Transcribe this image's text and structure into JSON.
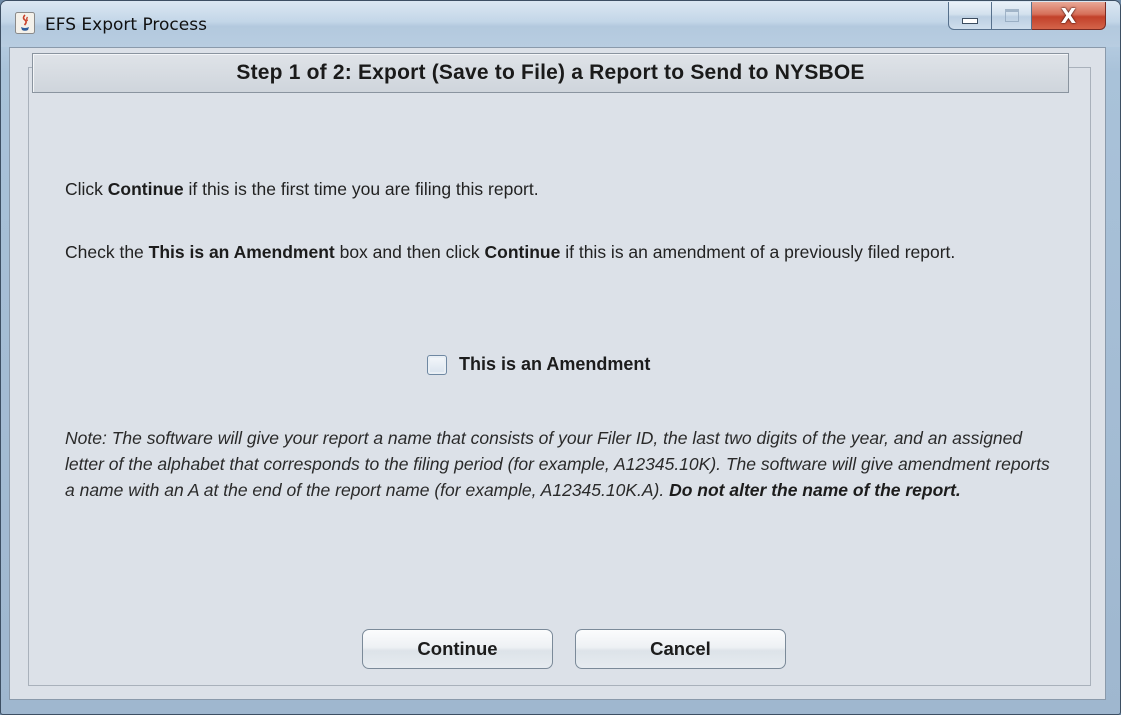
{
  "window": {
    "title": "EFS Export Process",
    "app_icon": "java-icon",
    "caption_buttons": {
      "minimize": "minimize-icon",
      "maximize": "maximize-icon",
      "close": "close-icon",
      "close_glyph": "X"
    }
  },
  "dialog": {
    "step_title": "Step 1 of 2:  Export (Save to File) a Report to Send to NYSBOE",
    "p1": {
      "before": "Click ",
      "bold1": "Continue",
      "after": " if this is the first time you are filing this report."
    },
    "p2": {
      "before": "Check the ",
      "bold1": "This is an Amendment",
      "middle": " box and then click ",
      "bold2": "Continue",
      "after": " if this is an amendment of a previously filed report."
    },
    "amendment_checkbox": {
      "label": "This is an Amendment",
      "checked": false
    },
    "note": {
      "text": "Note: The software will give your report a name that consists of your Filer ID, the last two digits of the year, and an assigned letter of the alphabet that corresponds to the filing period (for example, A12345.10K). The software will give amendment reports a name with an A at the end of the report name (for example, A12345.10K.A). ",
      "bold": "Do not alter the name of the report."
    },
    "buttons": {
      "continue": "Continue",
      "cancel": "Cancel"
    }
  }
}
